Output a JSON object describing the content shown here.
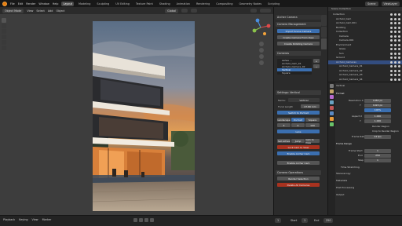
{
  "menubar": {
    "items": [
      "File",
      "Edit",
      "Render",
      "Window",
      "Help"
    ],
    "tabs": [
      "Layout",
      "Modeling",
      "Sculpting",
      "UV Editing",
      "Texture Paint",
      "Shading",
      "Animation",
      "Rendering",
      "Compositing",
      "Geometry Nodes",
      "Scripting"
    ],
    "active_tab": "Layout",
    "scene": "Scene",
    "view_layer": "ViewLayer"
  },
  "viewport_header": {
    "mode": "Object Mode",
    "menus": [
      "View",
      "Select",
      "Add",
      "Object"
    ],
    "orientation": "Global"
  },
  "npanel": {
    "title": "Archer Camera",
    "camera_management": "Camera Management",
    "import_btn": "Import Scene Camera",
    "create_btn": "Create Camera From View",
    "create_rot_btn": "Create Rotating Camera",
    "cameras_label": "Cameras",
    "camera_list": [
      "Ashes ...",
      "Archviz_Cam_01",
      "Archviz_Camera_02",
      "Vertical",
      "Square",
      "Horizontal"
    ],
    "selected_camera": "Vertical",
    "settings_label": "Settings: Vertical",
    "name_label": "Name:",
    "name_value": "Vertical",
    "focal_label": "Focal Length",
    "focal_value": "47.80 mm",
    "switch_btn": "Switch to Portrait",
    "landscape": "Landscape",
    "portrait": "Portrait",
    "square": "Square",
    "v1": "3",
    "v2": "4",
    "v3": "100",
    "lens_btn": "Lens",
    "set_active": "Set Active",
    "jump_view": "Jump",
    "cam_to_view": "Cam to View",
    "lock_cam": "Lock Cam to View",
    "enable_anim": "Enable Archer Cam",
    "ops_label": "Camera Operations",
    "rename_btn": "Render Selection",
    "delete_btn": "Delete All Cameras"
  },
  "outliner": {
    "title": "Scene Collection",
    "rows": [
      "Collection",
      "Archviz_Cam",
      "Archviz_Cam.001",
      "Building",
      "Collection",
      "Camera",
      "Camera.001",
      "Environment",
      "Glass",
      "Sun",
      "Ground",
      "Archviz_Cameras",
      "Archviz_Camera_01",
      "Archviz_Camera_02",
      "Archviz_Camera_03",
      "Archviz_Camera_04"
    ],
    "selected_row": "Archviz_Cameras"
  },
  "properties": {
    "header": "Vertical",
    "format_label": "Format",
    "resolution_x_label": "Resolution X",
    "resolution_x": "1080 px",
    "resolution_y_label": "Y",
    "resolution_y": "1920 px",
    "percent": "100%",
    "aspect_x_label": "Aspect X",
    "aspect_x": "1.000",
    "aspect_y_label": "Y",
    "aspect_y": "1.000",
    "render_region": "Render Region",
    "crop_region": "Crop to Render Region",
    "frame_rate_label": "Frame Rate",
    "frame_rate": "24 fps",
    "frame_range_label": "Frame Range",
    "frame_start_label": "Frame Start",
    "frame_start": "1",
    "end_label": "End",
    "frame_end": "250",
    "step_label": "Step",
    "step": "1",
    "time_stretching": "Time Stretching",
    "stereoscopy": "Stereoscopy",
    "metadata": "Metadata",
    "output": "Output",
    "post_processing": "Post Processing"
  },
  "timeline": {
    "menus": [
      "Playback",
      "Keying",
      "View",
      "Marker"
    ],
    "current_frame": "1",
    "start_label": "Start",
    "start": "1",
    "end_label": "End",
    "end": "250"
  }
}
